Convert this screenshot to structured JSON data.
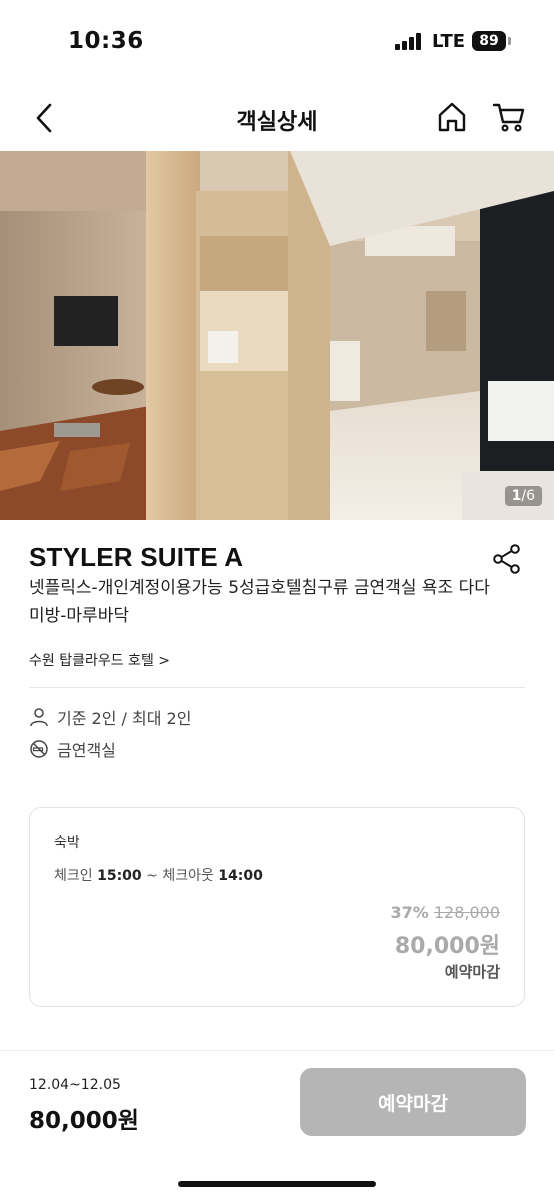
{
  "status_bar": {
    "time": "10:36",
    "network": "LTE",
    "battery": "89"
  },
  "nav": {
    "title": "객실상세",
    "icons": [
      "back-icon",
      "home-icon",
      "cart-icon"
    ]
  },
  "gallery": {
    "current": "1",
    "total": "/6"
  },
  "room": {
    "name": "STYLER SUITE A",
    "description": "넷플릭스-개인계정이용가능 5성급호텔침구류 금연객실 욕조 다다미방-마루바닥",
    "hotel_link": "수원 탑클라우드 호텔 >",
    "capacity": "기준 2인 / 최대 2인",
    "smoking": "금연객실"
  },
  "stay": {
    "type": "숙박",
    "checkin_label": "체크인",
    "checkin_time": "15:00",
    "separator": "~",
    "checkout_label": "체크아웃",
    "checkout_time": "14:00",
    "discount": "37%",
    "original_price": "128,000",
    "price": "80,000원",
    "status": "예약마감"
  },
  "bottom": {
    "dates": "12.04~12.05",
    "price": "80,000원",
    "cta": "예약마감"
  },
  "colors": {
    "disabled_button": "#b5b5b5",
    "muted_price": "#aaaaaa"
  }
}
